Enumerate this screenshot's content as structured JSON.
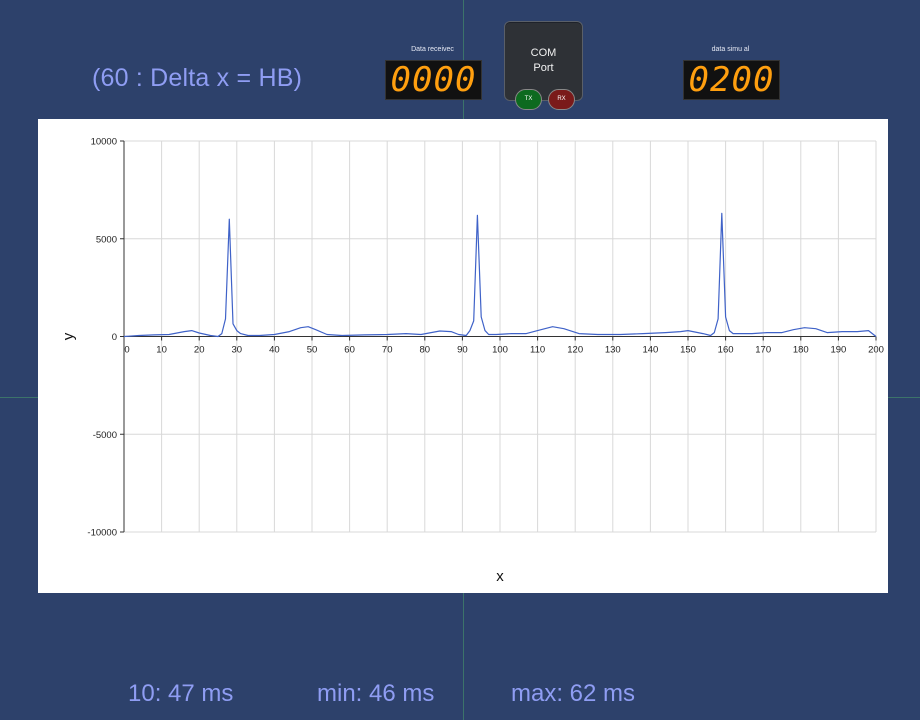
{
  "header": {
    "formula_text": "(60 : Delta x = HB)",
    "received": {
      "label": "Data receivec",
      "value": "0000"
    },
    "simulated": {
      "label": "data simu al",
      "value": "0200"
    },
    "com_port": {
      "title": "COM",
      "subtitle": "Port",
      "tx_label": "TX",
      "rx_label": "RX"
    }
  },
  "stats": {
    "ten": "10: 47 ms",
    "min": "min: 46 ms",
    "max": "max: 62 ms"
  },
  "colors": {
    "background": "#2d416b",
    "accent_text": "#8f9df3",
    "digit_color": "#ff9f0f",
    "series_line": "#3f62c8",
    "grid": "#d8d8d8"
  },
  "chart_data": {
    "type": "line",
    "xlabel": "x",
    "ylabel": "y",
    "xlim": [
      0,
      200
    ],
    "ylim": [
      -10000,
      10000
    ],
    "x_ticks": [
      0,
      10,
      20,
      30,
      40,
      50,
      60,
      70,
      80,
      90,
      100,
      110,
      120,
      130,
      140,
      150,
      160,
      170,
      180,
      190,
      200
    ],
    "y_ticks": [
      10000,
      5000,
      0,
      -5000,
      -10000
    ],
    "grid": "vertical and horizontal",
    "series": [
      {
        "x": [
          0,
          4,
          8,
          12,
          16,
          18,
          20,
          23,
          25,
          26,
          27,
          28,
          29,
          30,
          31,
          33,
          36,
          40,
          44,
          47,
          49,
          51,
          54,
          58,
          64,
          70,
          75,
          79,
          84,
          87,
          89,
          91,
          92,
          93,
          94,
          95,
          96,
          97,
          99,
          103,
          107,
          110,
          114,
          117,
          121,
          126,
          132,
          138,
          144,
          148,
          150,
          154,
          156,
          157,
          158,
          159,
          160,
          161,
          162,
          163,
          167,
          171,
          175,
          178,
          181,
          184,
          187,
          191,
          195,
          198,
          200
        ],
        "y": [
          0,
          50,
          80,
          100,
          250,
          300,
          180,
          50,
          0,
          150,
          900,
          6000,
          650,
          300,
          150,
          50,
          50,
          100,
          250,
          450,
          500,
          350,
          100,
          50,
          80,
          100,
          150,
          100,
          280,
          250,
          100,
          50,
          300,
          800,
          6200,
          1000,
          300,
          100,
          100,
          150,
          150,
          300,
          500,
          400,
          150,
          100,
          100,
          150,
          200,
          250,
          300,
          150,
          50,
          200,
          900,
          6300,
          1000,
          300,
          150,
          150,
          150,
          200,
          200,
          350,
          450,
          400,
          200,
          250,
          250,
          300,
          0
        ]
      }
    ]
  }
}
